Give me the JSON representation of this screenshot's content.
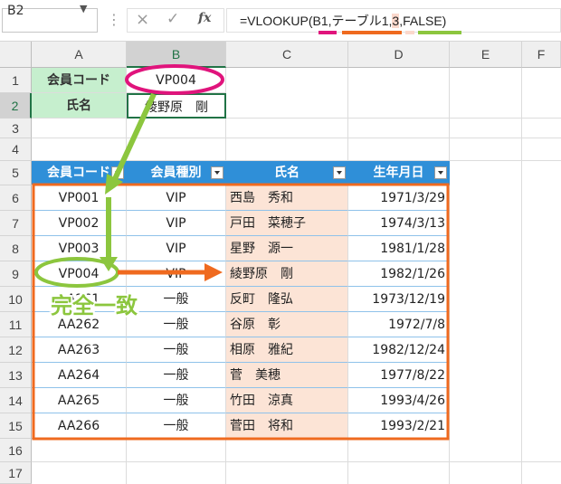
{
  "name_box": "B2",
  "formula": {
    "prefix": "=VLOOKUP(",
    "arg1": "B1",
    "sep1": ",",
    "arg2": "テーブル1",
    "sep2": ",",
    "arg3": "3",
    "sep3": ",",
    "arg4": "FALSE",
    "suffix": ")"
  },
  "toolbar": {
    "cancel": "×",
    "enter": "✓",
    "fx": "fx",
    "dots": "⋮"
  },
  "columns": [
    "A",
    "B",
    "C",
    "D",
    "E",
    "F"
  ],
  "rows": [
    "1",
    "2",
    "3",
    "4",
    "5",
    "6",
    "7",
    "8",
    "9",
    "10",
    "11",
    "12",
    "13",
    "14",
    "15",
    "16",
    "17"
  ],
  "lookup": {
    "label_code": "会員コード",
    "value_code": "VP004",
    "label_name": "氏名",
    "value_name": "綾野原　剛"
  },
  "table": {
    "headers": [
      "会員コード",
      "会員種別",
      "氏名",
      "生年月日"
    ],
    "rows": [
      [
        "VP001",
        "VIP",
        "西島　秀和",
        "1971/3/29"
      ],
      [
        "VP002",
        "VIP",
        "戸田　菜穂子",
        "1974/3/13"
      ],
      [
        "VP003",
        "VIP",
        "星野　源一",
        "1981/1/28"
      ],
      [
        "VP004",
        "VIP",
        "綾野原　剛",
        "1982/1/26"
      ],
      [
        "AA261",
        "一般",
        "反町　隆弘",
        "1973/12/19"
      ],
      [
        "AA262",
        "一般",
        "谷原　彰",
        "1972/7/8"
      ],
      [
        "AA263",
        "一般",
        "相原　雅紀",
        "1982/12/24"
      ],
      [
        "AA264",
        "一般",
        "菅　美穂",
        "1977/8/22"
      ],
      [
        "AA265",
        "一般",
        "竹田　涼真",
        "1993/4/26"
      ],
      [
        "AA266",
        "一般",
        "菅田　将和",
        "1993/2/21"
      ]
    ]
  },
  "annotation": {
    "exact_match": "完全一致"
  },
  "colors": {
    "magenta": "#e0147c",
    "orange": "#ef6a1f",
    "green": "#8cc63e",
    "header_blue": "#2f8fd8",
    "excel_green": "#217346"
  }
}
